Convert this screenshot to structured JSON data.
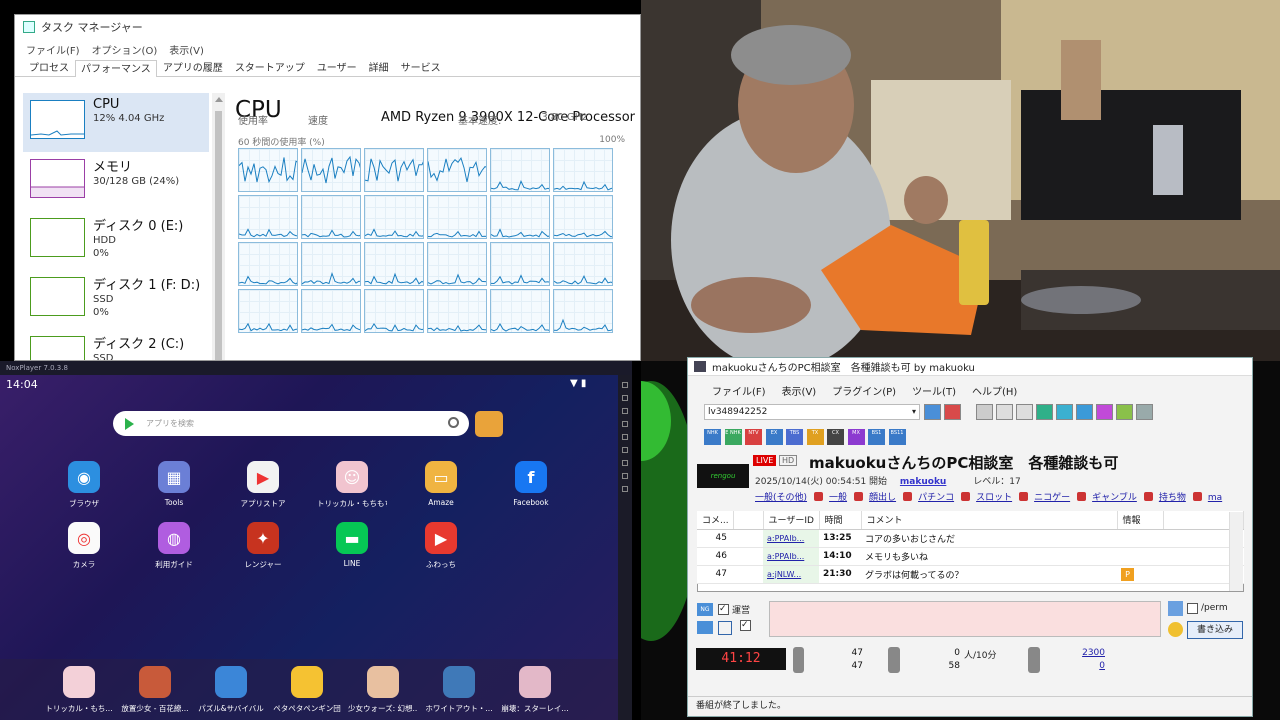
{
  "taskmgr": {
    "title": "タスク マネージャー",
    "menu": [
      "ファイル(F)",
      "オプション(O)",
      "表示(V)"
    ],
    "tabs": [
      "プロセス",
      "パフォーマンス",
      "アプリの履歴",
      "スタートアップ",
      "ユーザー",
      "詳細",
      "サービス"
    ],
    "side": [
      {
        "name": "CPU",
        "sub1": "12%  4.04 GHz",
        "sub2": "",
        "color": "#1a7fc1"
      },
      {
        "name": "メモリ",
        "sub1": "30/128 GB (24%)",
        "sub2": "",
        "color": "#9b3fa6"
      },
      {
        "name": "ディスク 0 (E:)",
        "sub1": "HDD",
        "sub2": "0%",
        "color": "#4c9c1e"
      },
      {
        "name": "ディスク 1 (F: D:)",
        "sub1": "SSD",
        "sub2": "0%",
        "color": "#4c9c1e"
      },
      {
        "name": "ディスク 2 (C:)",
        "sub1": "SSD",
        "sub2": "",
        "color": "#4c9c1e"
      }
    ],
    "cpu_title": "CPU",
    "processor": "AMD Ryzen 9 3900X 12-Core Processor",
    "usage_label": "60 秒間の使用率 (%)",
    "usage_max": "100%",
    "footer_left": "使用率",
    "footer_mid": "速度",
    "footer_base": "基本速度:",
    "footer_speed": "3.80 GHz"
  },
  "emulator": {
    "window_title": "NoxPlayer 7.0.3.8",
    "time": "14:04",
    "search_placeholder": "アプリを検索",
    "apps": [
      {
        "label": "ブラウザ",
        "color": "#2c8fe0",
        "glyph": "◉"
      },
      {
        "label": "Tools",
        "color": "#6b7fd6",
        "glyph": "▦"
      },
      {
        "label": "アプリストア",
        "color": "#f2f2f2",
        "glyph": "▶"
      },
      {
        "label": "トリッカル・もちもち...",
        "color": "#f1c4cf",
        "glyph": "☺"
      },
      {
        "label": "Amaze",
        "color": "#f0b441",
        "glyph": "▭"
      },
      {
        "label": "Facebook",
        "color": "#1877f2",
        "glyph": "f"
      },
      {
        "label": "カメラ",
        "color": "#fafafa",
        "glyph": "◎"
      },
      {
        "label": "利用ガイド",
        "color": "#b05de0",
        "glyph": "◍"
      },
      {
        "label": "レンジャー",
        "color": "#c7331f",
        "glyph": "✦"
      },
      {
        "label": "LINE",
        "color": "#06c755",
        "glyph": "▬"
      },
      {
        "label": "ふわっち",
        "color": "#e8392f",
        "glyph": "▶"
      }
    ],
    "dock": [
      {
        "label": "トリッカル・もち...",
        "color": "#f3d0d8"
      },
      {
        "label": "放置少女 - 百花繚...",
        "color": "#c85a3a"
      },
      {
        "label": "パズル&サバイバル",
        "color": "#3b86d8"
      },
      {
        "label": "ペタペタペンギン団",
        "color": "#f5c232"
      },
      {
        "label": "少女ウォーズ: 幻想...",
        "color": "#e8c0a0"
      },
      {
        "label": "ホワイトアウト・...",
        "color": "#3f79b8"
      },
      {
        "label": "崩壊：スターレイ...",
        "color": "#e3b8c8"
      }
    ]
  },
  "ncv": {
    "title": "makuokuさんちのPC相談室　各種雑談も可 by makuoku",
    "menu": [
      "ファイル(F)",
      "表示(V)",
      "プラグイン(P)",
      "ツール(T)",
      "ヘルプ(H)"
    ],
    "lv": "lv348942252",
    "channels": [
      "NHK",
      "E NHK",
      "NTV",
      "EX",
      "TBS",
      "TX",
      "CX",
      "MX",
      "BS1",
      "BS11"
    ],
    "badge_live": "LIVE",
    "badge_hd": "HD",
    "logo": "rengou",
    "program_title": "makuokuさんちのPC相談室　各種雑談も可",
    "start": "2025/10/14(火) 00:54:51 開始",
    "user": "makuoku",
    "level": "レベル：17",
    "tags": [
      "一般(その他)",
      "一般",
      "顔出し",
      "パチンコ",
      "スロット",
      "ニコゲー",
      "ギャンブル",
      "持ち物",
      "ma"
    ],
    "columns": [
      "コメ...",
      "ユーザーID",
      "時間",
      "コメント",
      "情報"
    ],
    "comments": [
      {
        "no": "45",
        "id": "a:PPAIb...",
        "time": "13:25",
        "text": "コアの多いおじさんだ",
        "info": ""
      },
      {
        "no": "46",
        "id": "a:PPAIb...",
        "time": "14:10",
        "text": "メモリも多いね",
        "info": ""
      },
      {
        "no": "47",
        "id": "a:jNLW...",
        "time": "21:30",
        "text": "グラボは何載ってるの？",
        "info": "P"
      }
    ],
    "ng": "NG",
    "unei": "運営",
    "perm": "/perm",
    "post": "書き込み",
    "timer": "41:12",
    "stat_a1": "47",
    "stat_a2": "47",
    "stat_b1": "0",
    "stat_b1_unit": "人/10分",
    "stat_b2": "58",
    "stat_c1": "2300",
    "stat_c2": "0",
    "status": "番組が終了しました。"
  }
}
